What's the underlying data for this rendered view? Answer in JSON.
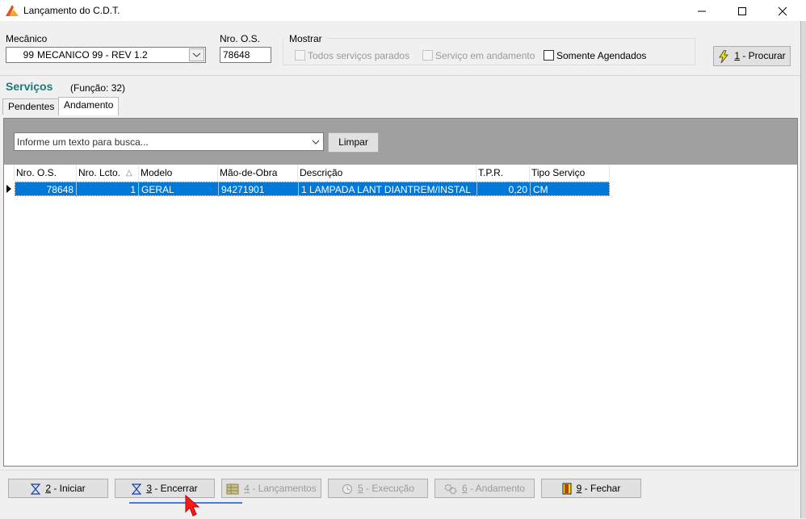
{
  "window": {
    "title": "Lançamento do C.D.T.",
    "controls": [
      "—",
      "☐",
      "✕"
    ]
  },
  "filters": {
    "mecanico_label": "Mecânico",
    "mecanico_code": "99",
    "mecanico_name": "MECANICO 99 - REV 1.2",
    "os_label": "Nro. O.S.",
    "os_value": "78648",
    "mostrar_label": "Mostrar",
    "opt_parados": "Todos serviços parados",
    "opt_andamento": "Serviço em andamento",
    "opt_agendados": "Somente Agendados",
    "procurar_key": "1",
    "procurar_rest": " - Procurar"
  },
  "section": {
    "title": "Serviços",
    "funcao": "(Função: 32)"
  },
  "tabs": [
    {
      "label": "Pendentes",
      "active": false
    },
    {
      "label": "Andamento",
      "active": true
    }
  ],
  "search": {
    "placeholder": "Informe um texto para busca...",
    "clear_label": "Limpar"
  },
  "table": {
    "headers": [
      "Nro. O.S.",
      "Nro. Lcto.",
      "Modelo",
      "Mão-de-Obra",
      "Descrição",
      "T.P.R.",
      "Tipo Serviço"
    ],
    "sort_glyph": "△",
    "rows": [
      [
        "78648",
        "1",
        "GERAL",
        "94271901",
        "1 LAMPADA LANT DIANTREM/INSTAL",
        "0,20",
        "CM"
      ]
    ]
  },
  "actions": [
    {
      "key": "2",
      "rest": " - Iniciar",
      "enabled": true,
      "icon": "hourglass-icon"
    },
    {
      "key": "3",
      "rest": " - Encerrar",
      "enabled": true,
      "icon": "hourglass-icon"
    },
    {
      "key": "4",
      "rest": " - Lançamentos",
      "enabled": false,
      "icon": "grid-icon"
    },
    {
      "key": "5",
      "rest": " - Execução",
      "enabled": false,
      "icon": "clock-icon"
    },
    {
      "key": "6",
      "rest": " - Andamento",
      "enabled": false,
      "icon": "gears-icon"
    },
    {
      "key": "9",
      "rest": " - Fechar",
      "enabled": true,
      "icon": "door-icon"
    }
  ],
  "colors": {
    "accent_teal": "#1a7a7a",
    "selection_blue": "#0078d7",
    "search_band": "#a0a0a0"
  }
}
